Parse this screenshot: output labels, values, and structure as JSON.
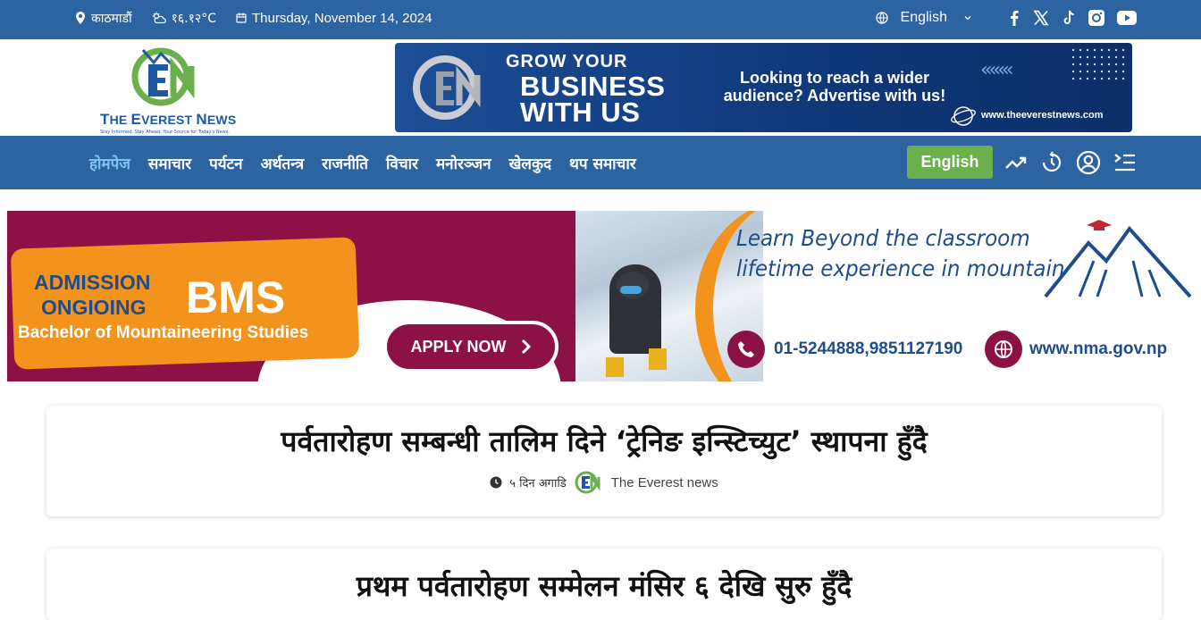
{
  "topbar": {
    "location": "काठमाडौं",
    "temperature": "१६.१२°C",
    "date": "Thursday, November 14, 2024",
    "language": "English",
    "social": [
      "facebook-icon",
      "x-icon",
      "tiktok-icon",
      "instagram-icon",
      "youtube-icon"
    ]
  },
  "brand": {
    "name_big_t": "T",
    "name_rest1": "HE ",
    "name_big_e": "E",
    "name_rest2": "VEREST ",
    "name_big_n": "N",
    "name_rest3": "EWS",
    "tagline": "Stay Informed, Stay Ahead: Your Source for Today's News."
  },
  "header_ad": {
    "line1": "GROW YOUR",
    "line2": "BUSINESS",
    "line3": "WITH US",
    "pitch": "Looking to reach a wider audience? Advertise with us!",
    "website": "www.theeverestnews.com"
  },
  "nav": {
    "items": [
      "होमपेज",
      "समाचार",
      "पर्यटन",
      "अर्थतन्त्र",
      "राजनीति",
      "विचार",
      "मनोरञ्जन",
      "खेलकुद",
      "थप समाचार"
    ],
    "english_button": "English"
  },
  "banner_ad": {
    "admission": "ADMISSION",
    "ongoing": "ONGIOING",
    "program": "BMS",
    "program_full": "Bachelor of Mountaineering Studies",
    "apply": "APPLY NOW",
    "learn1": "Learn Beyond the classroom",
    "learn2": "lifetime experience in mountain",
    "phone": "01-5244888,9851127190",
    "website": "www.nma.gov.np"
  },
  "article": {
    "title": "पर्वतारोहण सम्बन्धी तालिम दिने ‘ट्रेनिङ इन्स्टिच्युट’ स्थापना हुँदै",
    "time_ago": "५ दिन अगाडि",
    "author": "The Everest news"
  },
  "article2": {
    "title": "प्रथम पर्वतारोहण सम्मेलन मंसिर ६ देखि सुरु हुँदै"
  },
  "colors": {
    "brand_blue": "#2c63a1",
    "accent_green": "#6ab04c",
    "maroon": "#8c1245",
    "orange": "#f2931e"
  }
}
